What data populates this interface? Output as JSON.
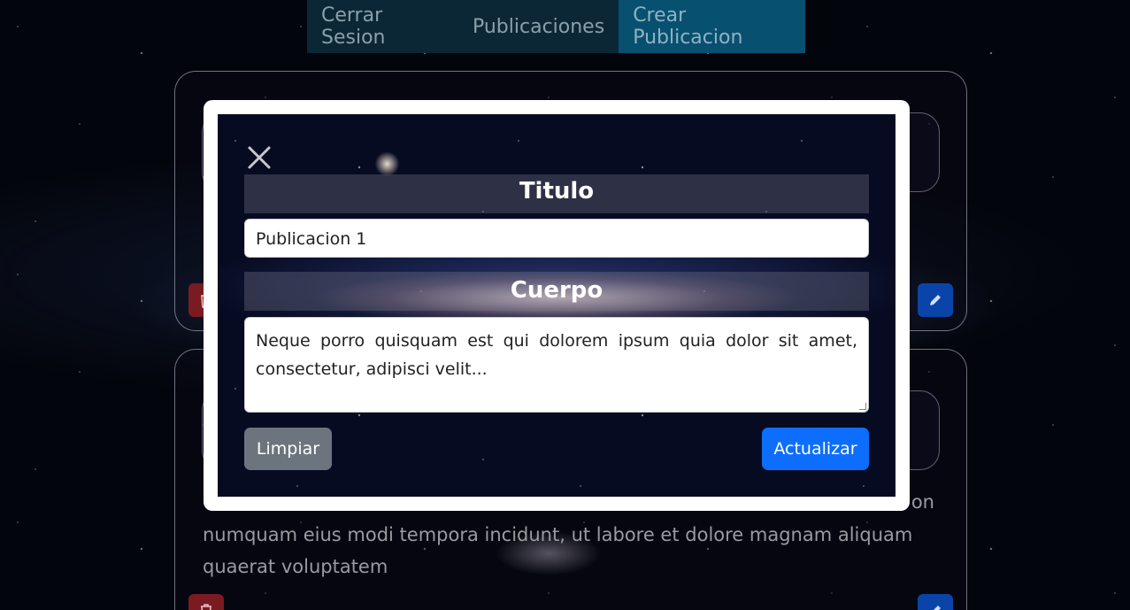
{
  "nav": {
    "items": [
      {
        "label": "Cerrar Sesion"
      },
      {
        "label": "Publicaciones"
      },
      {
        "label": "Crear Publicacion"
      }
    ],
    "active_index": 2
  },
  "background_post": {
    "body_text": "numquam eius modi tempora incidunt, ut labore et dolore magnam aliquam quaerat voluptatem",
    "body_partial_end": "on",
    "delete_icon": "trash-icon",
    "edit_icon": "pencil-icon"
  },
  "modal": {
    "close_icon": "close-icon",
    "title_label": "Titulo",
    "title_value": "Publicacion 1",
    "body_label": "Cuerpo",
    "body_value": "Neque porro quisquam est qui dolorem ipsum quia dolor sit amet, consectetur, adipisci velit...",
    "clear_label": "Limpiar",
    "update_label": "Actualizar"
  },
  "colors": {
    "nav_bg": "#0b2735",
    "nav_active_bg": "#08506f",
    "primary": "#0d6efd",
    "secondary": "#6c757d",
    "danger": "#7a1b22"
  }
}
